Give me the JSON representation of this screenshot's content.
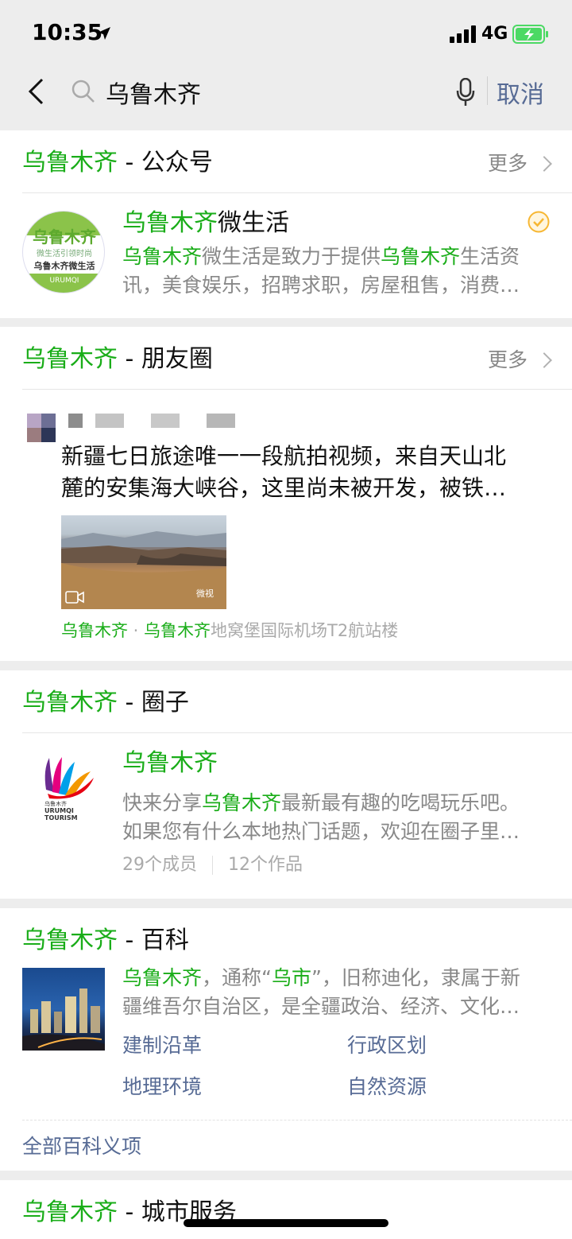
{
  "status_bar": {
    "time": "10:35",
    "network": "4G"
  },
  "search": {
    "query": "乌鲁木齐",
    "cancel_label": "取消"
  },
  "keyword": "乌鲁木齐",
  "sections": {
    "official": {
      "title_suffix": " - 公众号",
      "more_label": "更多",
      "account_name_suffix": "微生活",
      "desc_line1_a": "微生活是致力于提供",
      "desc_line1_b": "生活资",
      "desc_line2": "讯，美食娱乐，招聘求职，房屋租售，消费…",
      "logo_main": "乌鲁木齐",
      "logo_tagline": "微生活引领时尚",
      "logo_sub": "乌鲁木齐微生活",
      "logo_foot": "URUMQI"
    },
    "moments": {
      "title_suffix": " - 朋友圈",
      "more_label": "更多",
      "post_line1": "新疆七日旅途唯一一段航拍视频，来自天山北",
      "post_line2": "麓的安集海大峡谷，这里尚未被开发，被铁…",
      "video_badge": "微视",
      "location_a": "乌鲁木齐",
      "location_dot": " · ",
      "location_b": "乌鲁木齐",
      "location_rest": "地窝堡国际机场T2航站楼"
    },
    "circle": {
      "title_suffix": " - 圈子",
      "name": "乌鲁木齐",
      "desc_line1_a": "快来分享",
      "desc_line1_b": "最新最有趣的吃喝玩乐吧。",
      "desc_line2": "如果您有什么本地热门话题，欢迎在圈子里…",
      "members": "29个成员",
      "works": "12个作品",
      "logo_text1": "URUMQI",
      "logo_text2": "TOURISM",
      "logo_cn": "乌鲁木齐"
    },
    "baike": {
      "title_suffix": " - 百科",
      "desc_line1_a": "，通称“",
      "desc_line1_b": "乌市",
      "desc_line1_c": "”，旧称迪化，隶属于新",
      "desc_line2": "疆维吾尔自治区，是全疆政治、经济、文化…",
      "links": [
        "建制沿革",
        "行政区划",
        "地理环境",
        "自然资源"
      ],
      "all_label": "全部百科义项"
    },
    "city": {
      "title_suffix": " - 城市服务"
    }
  },
  "colors": {
    "accent_green": "#1aad19",
    "link_blue": "#576b95",
    "verified_orange": "#f7b733"
  },
  "icons": [
    "back-icon",
    "search-icon",
    "mic-icon",
    "chevron-right-icon",
    "verified-icon",
    "video-icon"
  ]
}
